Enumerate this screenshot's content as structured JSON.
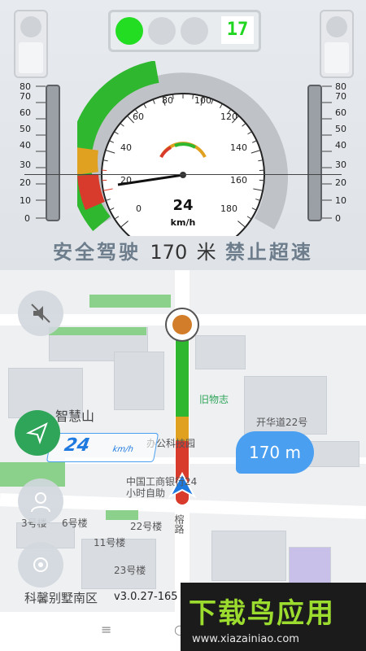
{
  "speed": {
    "value": "24",
    "unit": "km/h",
    "ticks": [
      "0",
      "20",
      "40",
      "60",
      "80",
      "100",
      "120",
      "140",
      "160",
      "180"
    ],
    "current": 24,
    "max": 180
  },
  "signal": {
    "countdown": "17",
    "active_color": "#22dd22"
  },
  "side_scales": {
    "ticks": [
      "80",
      "70",
      "60",
      "50",
      "40",
      "30",
      "20",
      "10",
      "0"
    ]
  },
  "status": {
    "prefix": "安全驾驶",
    "distance": "170",
    "distance_unit": "米",
    "suffix": "禁止超速"
  },
  "map": {
    "poi_1": "旧物志",
    "poi_2": "开华道22号",
    "poi_3": "智慧山",
    "poi_4": "办公科技园",
    "poi_5": "中国工商银行24",
    "poi_5b": "小时自助",
    "poi_6": "3号楼",
    "poi_7": "6号楼",
    "poi_8": "11号楼",
    "poi_9": "22号楼",
    "poi_10": "23号楼",
    "poi_11": "科馨别墅南区",
    "road_label": "榕路",
    "camera_speed": "24",
    "camera_unit": "km/h",
    "distance_pill": "170 m",
    "version": "v3.0.27-165",
    "brand_text": "下载鸟应用",
    "brand_url": "www.xiazainiao.com"
  },
  "bottom_nav": {
    "menu": "≡",
    "home": "○"
  }
}
